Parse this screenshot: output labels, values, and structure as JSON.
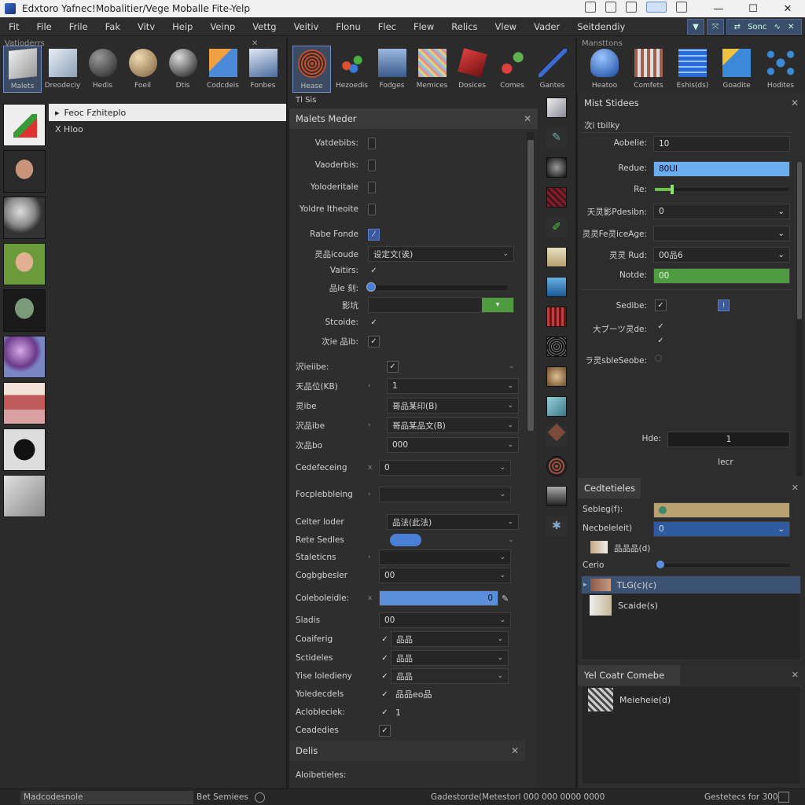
{
  "window": {
    "title": "Edxtoro Yafnec!Mobalitier/Vege Moballe Fite-Yelp"
  },
  "menubar": {
    "items": [
      "Fit",
      "File",
      "Frile",
      "Fak",
      "Vitv",
      "Heip",
      "Veinp",
      "Vettg",
      "Veitiv",
      "Flonu",
      "Flec",
      "Flew",
      "Relics",
      "Vlew",
      "Vader",
      "Seitdendiy"
    ],
    "right_group_label": "Sonc"
  },
  "panels": {
    "left_header": "Vatioderrs",
    "right_header": "Mansttons"
  },
  "shelf_left": [
    {
      "label": "Malets",
      "selected": true
    },
    {
      "label": "Dreodeciy",
      "selected": false
    },
    {
      "label": "Hedis",
      "selected": false
    },
    {
      "label": "Foeil",
      "selected": false
    },
    {
      "label": "Dtis",
      "selected": false
    },
    {
      "label": "Codcdeis",
      "selected": false
    },
    {
      "label": "Fonbes",
      "selected": false
    }
  ],
  "shelf_mid": [
    {
      "label": "Hease",
      "selected": true
    },
    {
      "label": "Hezoedis",
      "selected": false
    },
    {
      "label": "Fodges",
      "selected": false
    },
    {
      "label": "Memices",
      "selected": false
    },
    {
      "label": "Dosices",
      "selected": false
    },
    {
      "label": "Comes",
      "selected": false
    },
    {
      "label": "Gantes",
      "selected": false
    }
  ],
  "shelf_mid_caption": "Tl Sis",
  "shelf_right": [
    {
      "label": "Heatoo"
    },
    {
      "label": "Comfets"
    },
    {
      "label": "Eshis(ds)"
    },
    {
      "label": "Goadite"
    },
    {
      "label": "Hodites"
    }
  ],
  "outliner": {
    "row1": "Feoc Fzhiteplo",
    "row2": "X Hloo"
  },
  "material_panel": {
    "title": "Malets Meder",
    "rows": [
      {
        "label": "Vatdebibs:",
        "kind": "cbsmall"
      },
      {
        "label": "Vaoderbis:",
        "kind": "cbsmall"
      },
      {
        "label": "Yoloderitale",
        "kind": "cbsmall"
      },
      {
        "label": "Yoldre Itheoite",
        "kind": "cbsmall"
      },
      {
        "label": "Rabe Fonde",
        "kind": "cbblue",
        "value": "⁄"
      },
      {
        "label": "灵品icoude",
        "kind": "dropdown",
        "value": "设定文(诶)"
      },
      {
        "label": "Vaitirs:",
        "kind": "check",
        "value": "✓"
      },
      {
        "label": "品le 刻:",
        "kind": "slider"
      },
      {
        "label": "影坑",
        "kind": "greenfield"
      },
      {
        "label": "Stcoide:",
        "kind": "check",
        "value": "✓"
      },
      {
        "label": "次ie 品ib:",
        "kind": "check",
        "value": "✓"
      }
    ],
    "props": [
      {
        "label": "沢ieiibe:",
        "arrow": "",
        "value": "✓",
        "dropdown": "",
        "kind": "check"
      },
      {
        "label": "天品位(KB)",
        "arrow": "›",
        "value": "1",
        "kind": "dd"
      },
      {
        "label": "灵ibe",
        "arrow": "",
        "value": "哥品某印(B)",
        "kind": "dd"
      },
      {
        "label": "沢品ibe",
        "arrow": "›",
        "value": "哥品某品文(B)",
        "kind": "dd"
      },
      {
        "label": "次品bo",
        "arrow": "",
        "value": "000",
        "kind": "dd"
      },
      {
        "label": "Cedefeceing",
        "arrow": "x",
        "value": "0",
        "kind": "dd"
      },
      {
        "label": "Focplebbleing",
        "arrow": "›",
        "value": "",
        "kind": "dd"
      },
      {
        "label": "Celter loder",
        "arrow": "",
        "value": "品法(此法)",
        "kind": "dd"
      },
      {
        "label": "Rete Sedles",
        "arrow": "",
        "value": "",
        "kind": "pill"
      },
      {
        "label": "Staleticns",
        "arrow": "›",
        "value": "",
        "kind": "dd"
      },
      {
        "label": "Cogbgbesler",
        "arrow": "",
        "value": "00",
        "kind": "dd"
      },
      {
        "label": "Coleboleidle:",
        "arrow": "x",
        "value": "0",
        "kind": "bluefield"
      },
      {
        "label": "Sladis",
        "arrow": "",
        "value": "00",
        "kind": "dd"
      },
      {
        "label": "Coaiferig",
        "arrow": "",
        "value": "品品",
        "kind": "checkdd"
      },
      {
        "label": "Sctideles",
        "arrow": "",
        "value": "品品",
        "kind": "checkdd"
      },
      {
        "label": "Yise loledieny",
        "arrow": "",
        "value": "品品",
        "kind": "checkdd"
      },
      {
        "label": "Yoledecdels",
        "arrow": "",
        "value": "品品eo品",
        "kind": "checktext"
      },
      {
        "label": "Aclobleciek:",
        "arrow": "",
        "value": "1",
        "kind": "checktext"
      },
      {
        "label": "Ceadedies",
        "arrow": "",
        "value": "",
        "kind": "check"
      }
    ],
    "sub_panel_title": "Delis",
    "sub_panel_row": "Aloibetieles:"
  },
  "right_top": {
    "title": "Mist Stidees",
    "section": "次i tbilky",
    "rows": [
      {
        "label": "Aobelie:",
        "value": "10",
        "kind": "field"
      },
      {
        "label": "Redue:",
        "value": "80UI",
        "kind": "bluefield"
      },
      {
        "label": "Re:",
        "value": "",
        "kind": "slider"
      },
      {
        "label": "天灵影Pdesibn:",
        "value": "0",
        "kind": "dd"
      },
      {
        "label": "灵灵Fe灵iceAge:",
        "value": "",
        "kind": "dd"
      },
      {
        "label": "灵灵 Rud:",
        "value": "00品6",
        "kind": "dd"
      },
      {
        "label": "Notde:",
        "value": "00",
        "kind": "greenfield"
      }
    ],
    "checks": [
      {
        "label": "Sedibe:",
        "value": "✓"
      },
      {
        "label": "大ブーツ灵de:",
        "value": "✓"
      },
      {
        "label": "",
        "value": "✓"
      },
      {
        "label": "ラ灵sbleSeobe:",
        "value": ""
      }
    ],
    "count_label": "Hde:",
    "count_value": "1",
    "footer": "Iecr"
  },
  "right_mid": {
    "title": "Cedtetieles",
    "rows": [
      {
        "label": "Sebleg(f):",
        "kind": "tanfield",
        "value": ""
      },
      {
        "label": "Necbeleleit)",
        "kind": "bluedd",
        "value": "0"
      }
    ],
    "list": [
      {
        "label": "品品品(d)"
      },
      {
        "label": "Cerio",
        "kind": "slider"
      },
      {
        "label": "TLG(c)(c)",
        "selected": true
      },
      {
        "label": "Scaide(s)"
      }
    ]
  },
  "right_bottom": {
    "title": "Yel Coatr Comebe",
    "item": "Meieheie(d)"
  },
  "statusbar": {
    "left": "Madcodesnole",
    "mid": "Bet Semiees",
    "right": "Gadestorde(Metestorl 000 000 0000 0000",
    "far_right": "Gestetecs for 300"
  },
  "colors": {
    "accent_blue": "#5b8fd9",
    "accent_green": "#4e9c3f",
    "accent_tan": "#b8a070"
  }
}
